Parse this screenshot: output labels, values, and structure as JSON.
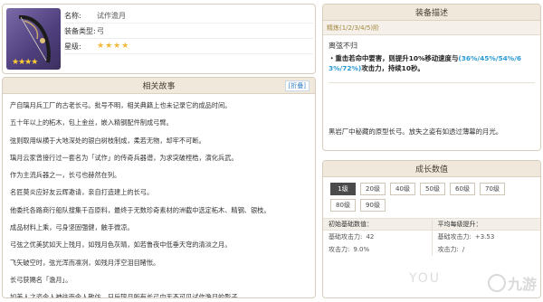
{
  "weapon": {
    "stars": "★★★★",
    "rows": [
      {
        "key": "名称:",
        "value": "试作澹月"
      },
      {
        "key": "装备类型:",
        "value": "弓"
      },
      {
        "key": "星级:",
        "value": "★★★★"
      }
    ]
  },
  "story": {
    "title": "相关故事",
    "fold_label": "[折叠]",
    "lines": [
      "产自璃月兵工厂的古老长弓。批号不明，相关典籍上也未记录它的成品时间。",
      "五十年以上的柘木，包上金丝，嵌入精钢配件制成弓臂。",
      "弦则取用纵横于大地深处的银白树枝制成，柔若无物，却牢不可断。",
      "璃月云家曾接行过一套名为「试作」的传奇兵器谱，为求突破桎梏，演化兵武。",
      "作为主流兵器之一，长弓也赫然在列。",
      "名匠莫炎应好友云辉邀请，亲自打造建上的长弓。",
      "他委托各路商行船队搜集千百原料，最终于无数珍奇素材的洲截中选定柘木、精钢、银枝。",
      "成品材料上乘，弓身坚固强健，触手微凉。",
      "弓弦之优美犹如天上残月，如残月色灰晴，如若鲁夜中低垂天穹的清淡之月。",
      "飞矢破空时，弦光浑而凛冽，如残月浮空泪目睹怅。",
      "长弓获赐名「澹月」。",
      "如美人之姿令人神往而令人敬仿，日后璃月所有长弓中无不可见试作澹月的影子。"
    ]
  },
  "description": {
    "title": "装备描述",
    "tab_label": "精炼(1/2/3/4/5)阶",
    "skill_title": "离弦不归",
    "skill_prefix": "・重击若命中要害，则提升10%移动速度与",
    "skill_values": "(36%/45%/54%/6",
    "skill_values2": "3%/72%)",
    "skill_suffix": "攻击力，持续10秒。",
    "flavor": "黑岩厂中秘藏的原型长弓。放失之姿有如透过薄幕的月光。"
  },
  "growth": {
    "title": "成长数值",
    "levels": [
      "1级",
      "20级",
      "40级",
      "50级",
      "60级",
      "70级",
      "80级",
      "90级"
    ],
    "active_level": "1级",
    "base_head": "初始基础数值：",
    "avg_head": "平均每级提升：",
    "base_stats": [
      {
        "label": "基础攻击力:",
        "value": "42"
      },
      {
        "label": "攻击力:",
        "value": "9.0%"
      }
    ],
    "avg_stats": [
      {
        "label": "基础攻击力:",
        "value": "+3.53"
      },
      {
        "label": "攻击力:",
        "value": "/"
      }
    ]
  },
  "watermark": {
    "text": "九游",
    "faint": "YOU"
  },
  "colors": {
    "accent": "#2a9ad4",
    "panel_head": "#efe8db",
    "star": "#ffcc33"
  }
}
